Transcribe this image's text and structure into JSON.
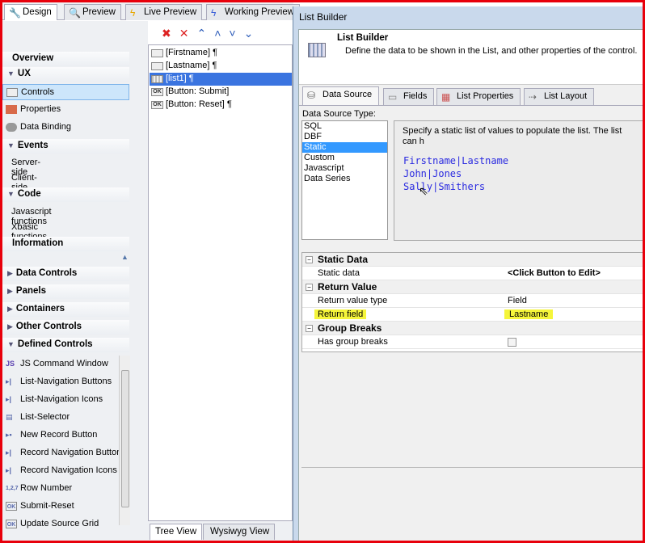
{
  "top_tabs": [
    {
      "label": "Design",
      "icon": "design-tools-icon"
    },
    {
      "label": "Preview",
      "icon": "preview-icon"
    },
    {
      "label": "Live Preview",
      "icon": "lightning-icon"
    },
    {
      "label": "Working Preview",
      "icon": "lightning-icon"
    }
  ],
  "sidebar": {
    "overview": "Overview",
    "ux": "UX",
    "controls": "Controls",
    "properties": "Properties",
    "data_binding": "Data Binding",
    "events": "Events",
    "server_side": "Server-side",
    "client_side": "Client-side",
    "code": "Code",
    "js_functions": "Javascript functions",
    "xbasic_functions": "Xbasic functions",
    "information": "Information",
    "groups": [
      "Data Controls",
      "Panels",
      "Containers",
      "Other Controls"
    ],
    "defined_controls": "Defined Controls",
    "defined_items": [
      {
        "label": "JS Command Window",
        "icon": "JS"
      },
      {
        "label": "List-Navigation Buttons",
        "icon": "▸|"
      },
      {
        "label": "List-Navigation Icons",
        "icon": "▸|"
      },
      {
        "label": "List-Selector",
        "icon": "▤"
      },
      {
        "label": "New Record Button",
        "icon": "▸•"
      },
      {
        "label": "Record Navigation Buttons",
        "icon": "▸|"
      },
      {
        "label": "Record Navigation Icons",
        "icon": "▸|"
      },
      {
        "label": "Row Number",
        "icon": "1,2,7"
      },
      {
        "label": "Submit-Reset",
        "icon": "OK"
      },
      {
        "label": "Update Source Grid",
        "icon": "OK"
      }
    ]
  },
  "tree": {
    "items": [
      {
        "label": "[Firstname] ¶",
        "icon": "I"
      },
      {
        "label": "[Lastname] ¶",
        "icon": "I"
      },
      {
        "label": "[list1] ¶",
        "icon": "|||"
      },
      {
        "label": "[Button: Submit]",
        "icon": "OK"
      },
      {
        "label": "[Button: Reset] ¶",
        "icon": "OK"
      }
    ],
    "bottom_tabs": [
      "Tree View",
      "Wysiwyg View"
    ]
  },
  "dialog": {
    "window_title": "List Builder",
    "header_title": "List Builder",
    "header_desc": "Define the data to be shown in the List, and other properties of the control.",
    "tabs": [
      "Data Source",
      "Fields",
      "List Properties",
      "List Layout"
    ],
    "ds_type_label": "Data Source Type:",
    "ds_types": [
      "SQL",
      "DBF",
      "Static",
      "Custom",
      "Javascript",
      "Data Series"
    ],
    "ds_selected": "Static",
    "static_desc": "Specify a static list of values to populate the list. The list can h",
    "static_lines": [
      "Firstname|Lastname",
      "John|Jones",
      "Sally|Smithers"
    ],
    "props": {
      "static_data_cat": "Static Data",
      "static_data_label": "Static data",
      "static_data_value": "<Click Button to Edit>",
      "return_cat": "Return Value",
      "return_type_label": "Return value type",
      "return_type_value": "Field",
      "return_field_label": "Return field",
      "return_field_value": "Lastname",
      "group_cat": "Group Breaks",
      "group_label": "Has group breaks",
      "group_checked": false
    },
    "highlight_color": "#f5f53a"
  }
}
